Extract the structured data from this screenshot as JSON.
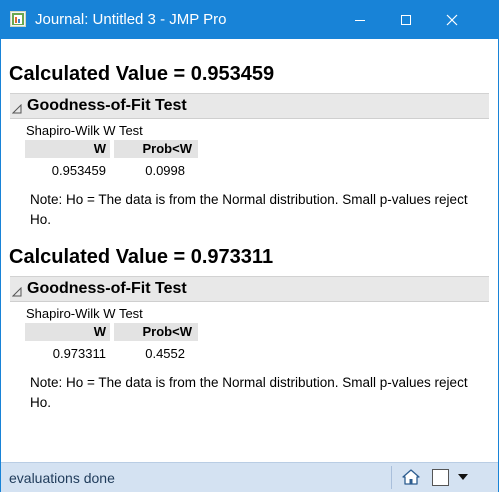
{
  "window": {
    "title": "Journal: Untitled 3 - JMP Pro",
    "icons": {
      "app": "jmp-journal-icon",
      "minimize": "minimize-icon",
      "maximize": "maximize-icon",
      "close": "close-icon"
    }
  },
  "reports": [
    {
      "calc_title": "Calculated Value = 0.953459",
      "outline_title": "Goodness-of-Fit Test",
      "test_name": "Shapiro-Wilk W Test",
      "columns": [
        "W",
        "Prob<W"
      ],
      "values": [
        "0.953459",
        "0.0998"
      ],
      "note": "Note: Ho = The data is from the Normal distribution. Small p-values reject Ho."
    },
    {
      "calc_title": "Calculated Value = 0.973311",
      "outline_title": "Goodness-of-Fit Test",
      "test_name": "Shapiro-Wilk W Test",
      "columns": [
        "W",
        "Prob<W"
      ],
      "values": [
        "0.973311",
        "0.4552"
      ],
      "note": "Note: Ho = The data is from the Normal distribution. Small p-values reject Ho."
    }
  ],
  "statusbar": {
    "text": "evaluations done",
    "icons": {
      "home": "home-icon",
      "checkbox": "checkbox-icon",
      "dropdown": "dropdown-arrow-icon"
    }
  },
  "colors": {
    "titlebar": "#1883d7",
    "statusbar": "#d4e2f2",
    "outline": "#e8e8e8"
  }
}
